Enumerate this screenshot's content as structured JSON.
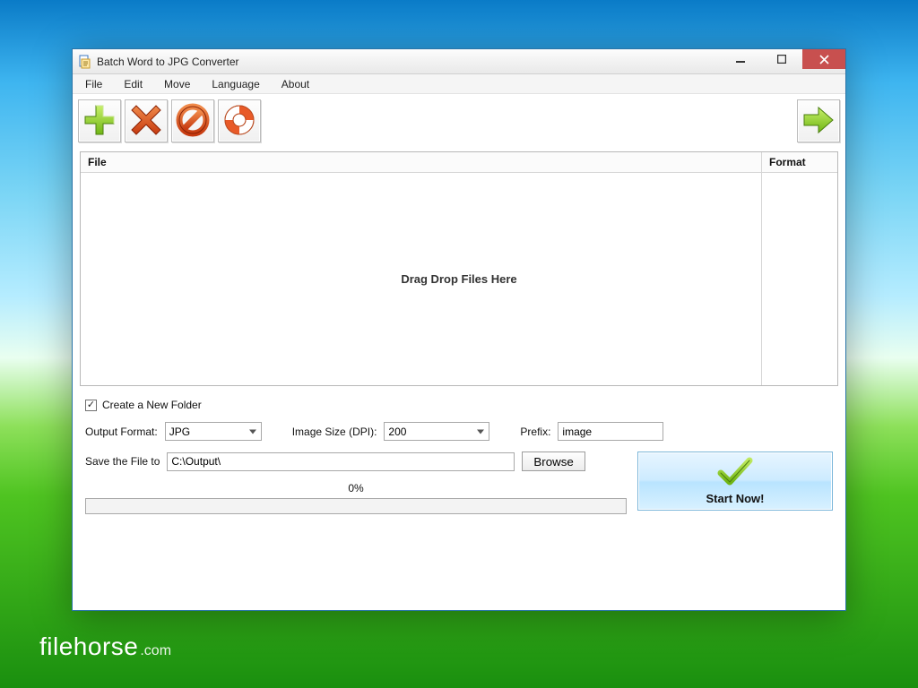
{
  "window": {
    "title": "Batch Word to JPG Converter"
  },
  "menu": {
    "items": [
      "File",
      "Edit",
      "Move",
      "Language",
      "About"
    ]
  },
  "toolbar": {
    "add": "add",
    "remove": "remove",
    "clear": "clear",
    "help": "help",
    "next": "next"
  },
  "filelist": {
    "col_file": "File",
    "col_format": "Format",
    "drag_hint": "Drag  Drop Files Here"
  },
  "options": {
    "create_folder_label": "Create a New Folder",
    "output_format_label": "Output Format:",
    "output_format_value": "JPG",
    "image_size_label": "Image Size (DPI):",
    "image_size_value": "200",
    "prefix_label": "Prefix:",
    "prefix_value": "image",
    "save_to_label": "Save the File to",
    "save_to_value": "C:\\Output\\",
    "browse_label": "Browse",
    "progress_pct": "0%",
    "start_label": "Start Now!"
  },
  "watermark": {
    "brand": "filehorse",
    "tld": ".com"
  }
}
